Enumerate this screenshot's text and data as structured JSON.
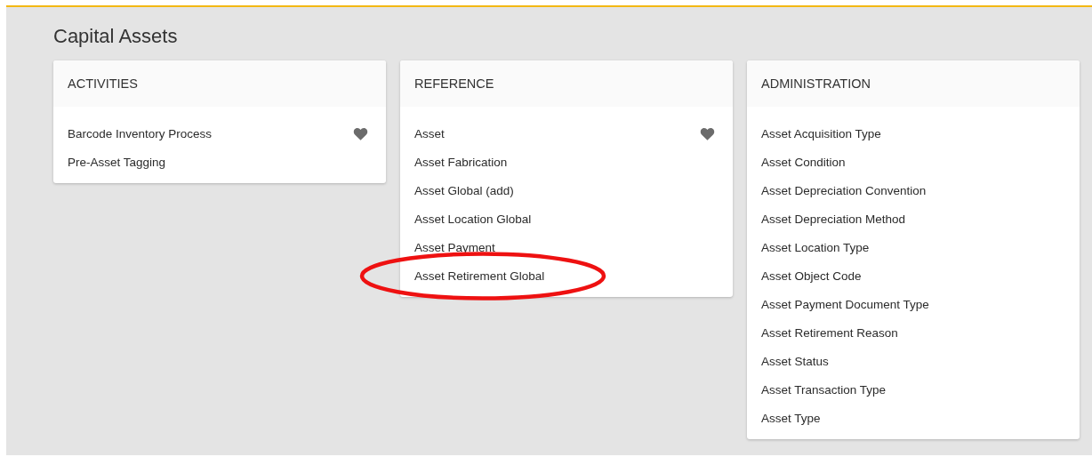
{
  "page_title": "Capital Assets",
  "cards": [
    {
      "title": "ACTIVITIES",
      "items": [
        {
          "label": "Barcode Inventory Process",
          "favorite": true,
          "circled": false
        },
        {
          "label": "Pre-Asset Tagging",
          "favorite": false,
          "circled": false
        }
      ]
    },
    {
      "title": "REFERENCE",
      "items": [
        {
          "label": "Asset",
          "favorite": true,
          "circled": false
        },
        {
          "label": "Asset Fabrication",
          "favorite": false,
          "circled": false
        },
        {
          "label": "Asset Global (add)",
          "favorite": false,
          "circled": false
        },
        {
          "label": "Asset Location Global",
          "favorite": false,
          "circled": false
        },
        {
          "label": "Asset Payment",
          "favorite": false,
          "circled": false
        },
        {
          "label": "Asset Retirement Global",
          "favorite": false,
          "circled": true
        }
      ]
    },
    {
      "title": "ADMINISTRATION",
      "items": [
        {
          "label": "Asset Acquisition Type",
          "favorite": false,
          "circled": false
        },
        {
          "label": "Asset Condition",
          "favorite": false,
          "circled": false
        },
        {
          "label": "Asset Depreciation Convention",
          "favorite": false,
          "circled": false
        },
        {
          "label": "Asset Depreciation Method",
          "favorite": false,
          "circled": false
        },
        {
          "label": "Asset Location Type",
          "favorite": false,
          "circled": false
        },
        {
          "label": "Asset Object Code",
          "favorite": false,
          "circled": false
        },
        {
          "label": "Asset Payment Document Type",
          "favorite": false,
          "circled": false
        },
        {
          "label": "Asset Retirement Reason",
          "favorite": false,
          "circled": false
        },
        {
          "label": "Asset Status",
          "favorite": false,
          "circled": false
        },
        {
          "label": "Asset Transaction Type",
          "favorite": false,
          "circled": false
        },
        {
          "label": "Asset Type",
          "favorite": false,
          "circled": false
        }
      ]
    }
  ]
}
